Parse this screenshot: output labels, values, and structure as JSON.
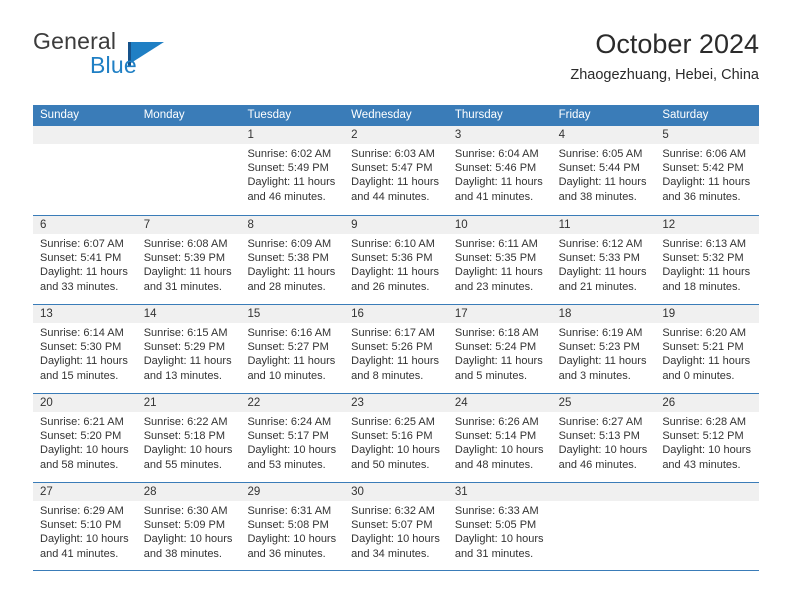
{
  "brand": {
    "name_top": "General",
    "name_bottom": "Blue",
    "flag_icon": "general-blue-flag-icon",
    "color_top": "#3c3c3c",
    "color_bottom": "#1f7fc4"
  },
  "header": {
    "title": "October 2024",
    "subtitle": "Zhaogezhuang, Hebei, China"
  },
  "theme": {
    "header_blue": "#3a7cb8",
    "day_strip_gray": "#f0f0f0",
    "text": "#333333"
  },
  "weekdays": [
    "Sunday",
    "Monday",
    "Tuesday",
    "Wednesday",
    "Thursday",
    "Friday",
    "Saturday"
  ],
  "weeks": [
    [
      {
        "day": "",
        "lines": []
      },
      {
        "day": "",
        "lines": []
      },
      {
        "day": "1",
        "lines": [
          "Sunrise: 6:02 AM",
          "Sunset: 5:49 PM",
          "Daylight: 11 hours",
          "and 46 minutes."
        ]
      },
      {
        "day": "2",
        "lines": [
          "Sunrise: 6:03 AM",
          "Sunset: 5:47 PM",
          "Daylight: 11 hours",
          "and 44 minutes."
        ]
      },
      {
        "day": "3",
        "lines": [
          "Sunrise: 6:04 AM",
          "Sunset: 5:46 PM",
          "Daylight: 11 hours",
          "and 41 minutes."
        ]
      },
      {
        "day": "4",
        "lines": [
          "Sunrise: 6:05 AM",
          "Sunset: 5:44 PM",
          "Daylight: 11 hours",
          "and 38 minutes."
        ]
      },
      {
        "day": "5",
        "lines": [
          "Sunrise: 6:06 AM",
          "Sunset: 5:42 PM",
          "Daylight: 11 hours",
          "and 36 minutes."
        ]
      }
    ],
    [
      {
        "day": "6",
        "lines": [
          "Sunrise: 6:07 AM",
          "Sunset: 5:41 PM",
          "Daylight: 11 hours",
          "and 33 minutes."
        ]
      },
      {
        "day": "7",
        "lines": [
          "Sunrise: 6:08 AM",
          "Sunset: 5:39 PM",
          "Daylight: 11 hours",
          "and 31 minutes."
        ]
      },
      {
        "day": "8",
        "lines": [
          "Sunrise: 6:09 AM",
          "Sunset: 5:38 PM",
          "Daylight: 11 hours",
          "and 28 minutes."
        ]
      },
      {
        "day": "9",
        "lines": [
          "Sunrise: 6:10 AM",
          "Sunset: 5:36 PM",
          "Daylight: 11 hours",
          "and 26 minutes."
        ]
      },
      {
        "day": "10",
        "lines": [
          "Sunrise: 6:11 AM",
          "Sunset: 5:35 PM",
          "Daylight: 11 hours",
          "and 23 minutes."
        ]
      },
      {
        "day": "11",
        "lines": [
          "Sunrise: 6:12 AM",
          "Sunset: 5:33 PM",
          "Daylight: 11 hours",
          "and 21 minutes."
        ]
      },
      {
        "day": "12",
        "lines": [
          "Sunrise: 6:13 AM",
          "Sunset: 5:32 PM",
          "Daylight: 11 hours",
          "and 18 minutes."
        ]
      }
    ],
    [
      {
        "day": "13",
        "lines": [
          "Sunrise: 6:14 AM",
          "Sunset: 5:30 PM",
          "Daylight: 11 hours",
          "and 15 minutes."
        ]
      },
      {
        "day": "14",
        "lines": [
          "Sunrise: 6:15 AM",
          "Sunset: 5:29 PM",
          "Daylight: 11 hours",
          "and 13 minutes."
        ]
      },
      {
        "day": "15",
        "lines": [
          "Sunrise: 6:16 AM",
          "Sunset: 5:27 PM",
          "Daylight: 11 hours",
          "and 10 minutes."
        ]
      },
      {
        "day": "16",
        "lines": [
          "Sunrise: 6:17 AM",
          "Sunset: 5:26 PM",
          "Daylight: 11 hours",
          "and 8 minutes."
        ]
      },
      {
        "day": "17",
        "lines": [
          "Sunrise: 6:18 AM",
          "Sunset: 5:24 PM",
          "Daylight: 11 hours",
          "and 5 minutes."
        ]
      },
      {
        "day": "18",
        "lines": [
          "Sunrise: 6:19 AM",
          "Sunset: 5:23 PM",
          "Daylight: 11 hours",
          "and 3 minutes."
        ]
      },
      {
        "day": "19",
        "lines": [
          "Sunrise: 6:20 AM",
          "Sunset: 5:21 PM",
          "Daylight: 11 hours",
          "and 0 minutes."
        ]
      }
    ],
    [
      {
        "day": "20",
        "lines": [
          "Sunrise: 6:21 AM",
          "Sunset: 5:20 PM",
          "Daylight: 10 hours",
          "and 58 minutes."
        ]
      },
      {
        "day": "21",
        "lines": [
          "Sunrise: 6:22 AM",
          "Sunset: 5:18 PM",
          "Daylight: 10 hours",
          "and 55 minutes."
        ]
      },
      {
        "day": "22",
        "lines": [
          "Sunrise: 6:24 AM",
          "Sunset: 5:17 PM",
          "Daylight: 10 hours",
          "and 53 minutes."
        ]
      },
      {
        "day": "23",
        "lines": [
          "Sunrise: 6:25 AM",
          "Sunset: 5:16 PM",
          "Daylight: 10 hours",
          "and 50 minutes."
        ]
      },
      {
        "day": "24",
        "lines": [
          "Sunrise: 6:26 AM",
          "Sunset: 5:14 PM",
          "Daylight: 10 hours",
          "and 48 minutes."
        ]
      },
      {
        "day": "25",
        "lines": [
          "Sunrise: 6:27 AM",
          "Sunset: 5:13 PM",
          "Daylight: 10 hours",
          "and 46 minutes."
        ]
      },
      {
        "day": "26",
        "lines": [
          "Sunrise: 6:28 AM",
          "Sunset: 5:12 PM",
          "Daylight: 10 hours",
          "and 43 minutes."
        ]
      }
    ],
    [
      {
        "day": "27",
        "lines": [
          "Sunrise: 6:29 AM",
          "Sunset: 5:10 PM",
          "Daylight: 10 hours",
          "and 41 minutes."
        ]
      },
      {
        "day": "28",
        "lines": [
          "Sunrise: 6:30 AM",
          "Sunset: 5:09 PM",
          "Daylight: 10 hours",
          "and 38 minutes."
        ]
      },
      {
        "day": "29",
        "lines": [
          "Sunrise: 6:31 AM",
          "Sunset: 5:08 PM",
          "Daylight: 10 hours",
          "and 36 minutes."
        ]
      },
      {
        "day": "30",
        "lines": [
          "Sunrise: 6:32 AM",
          "Sunset: 5:07 PM",
          "Daylight: 10 hours",
          "and 34 minutes."
        ]
      },
      {
        "day": "31",
        "lines": [
          "Sunrise: 6:33 AM",
          "Sunset: 5:05 PM",
          "Daylight: 10 hours",
          "and 31 minutes."
        ]
      },
      {
        "day": "",
        "lines": []
      },
      {
        "day": "",
        "lines": []
      }
    ]
  ]
}
